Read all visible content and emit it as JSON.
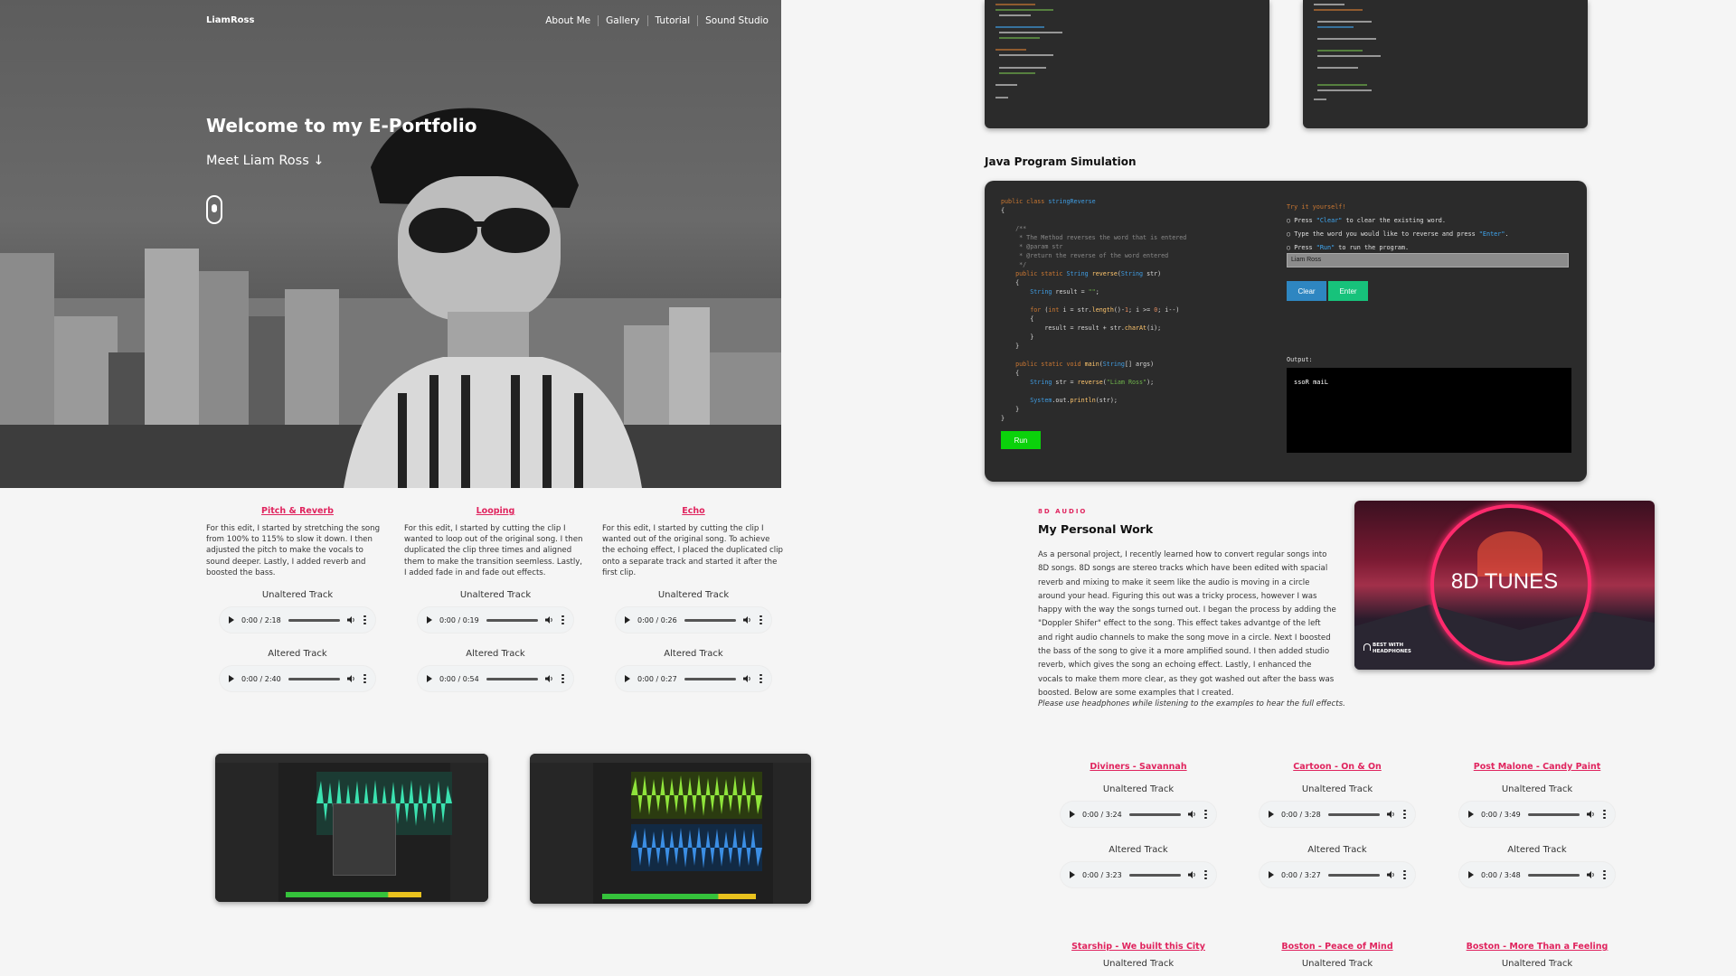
{
  "nav": {
    "logo": "LiamRoss",
    "links": [
      "About Me",
      "Gallery",
      "Tutorial",
      "Sound Studio"
    ]
  },
  "hero": {
    "title": "Welcome to my E-Portfolio",
    "subtitle": "Meet Liam Ross ↓"
  },
  "edits": [
    {
      "title": "Pitch & Reverb",
      "text": "For this edit, I started by stretching the song from 100% to 115% to slow it down. I then adjusted the pitch to make the vocals to sound deeper. Lastly, I added reverb and boosted the bass.",
      "unaltered_label": "Unaltered Track",
      "unaltered_time": "0:00 / 2:18",
      "altered_label": "Altered Track",
      "altered_time": "0:00 / 2:40"
    },
    {
      "title": "Looping",
      "text": "For this edit, I started by cutting the clip I wanted to loop out of the original song. I then duplicated the clip three times and aligned them to make the transition seemless. Lastly, I added fade in and fade out effects.",
      "unaltered_label": "Unaltered Track",
      "unaltered_time": "0:00 / 0:19",
      "altered_label": "Altered Track",
      "altered_time": "0:00 / 0:54"
    },
    {
      "title": "Echo",
      "text": "For this edit, I started by cutting the clip I wanted out of the original song. To achieve the echoing effect, I placed the duplicated clip onto a separate track and started it after the first clip.",
      "unaltered_label": "Unaltered Track",
      "unaltered_time": "0:00 / 0:26",
      "altered_label": "Altered Track",
      "altered_time": "0:00 / 0:27"
    }
  ],
  "java": {
    "section_title": "Java Program Simulation",
    "run_label": "Run",
    "try_head": "Try it yourself!",
    "instr1_a": "Press ",
    "instr1_q": "\"Clear\"",
    "instr1_b": " to clear the existing word.",
    "instr2_a": "Type the word you would like to reverse and press ",
    "instr2_q": "\"Enter\"",
    "instr2_b": ".",
    "instr3_a": "Press ",
    "instr3_q": "\"Run\"",
    "instr3_b": " to run the program.",
    "input_value": "Liam Ross",
    "clear_label": "Clear",
    "enter_label": "Enter",
    "output_label": "Output:",
    "output_value": "ssoR maiL"
  },
  "personal": {
    "eyebrow": "8D AUDIO",
    "title": "My Personal Work",
    "text": "As a personal project, I recently learned how to convert regular songs into 8D songs. 8D songs are stereo tracks which have been edited with spacial reverb and mixing to make it seem like the audio is moving in a circle around your head. Figuring this out was a tricky process, however I was happy with the way the songs turned out. I began the process by adding the \"Doppler Shifer\" effect to the song. This effect takes advantge of the left and right audio channels to make the song move in a circle. Next I boosted the bass of the song to give it a more amplified sound. I then added studio reverb, which gives the song an echoing effect. Lastly, I enhanced the vocals to make them more clear, as they got washed out after the bass was boosted. Below are some examples that I created.",
    "note": "Please use headphones while listening to the examples to hear the full effects.",
    "image_label": "8D TUNES",
    "headphone_line1": "BEST WITH",
    "headphone_line2": "HEADPHONES"
  },
  "songs": [
    {
      "title": "Diviners - Savannah",
      "unaltered_label": "Unaltered Track",
      "unaltered_time": "0:00 / 3:24",
      "altered_label": "Altered Track",
      "altered_time": "0:00 / 3:23"
    },
    {
      "title": "Cartoon - On & On",
      "unaltered_label": "Unaltered Track",
      "unaltered_time": "0:00 / 3:28",
      "altered_label": "Altered Track",
      "altered_time": "0:00 / 3:27"
    },
    {
      "title": "Post Malone - Candy Paint",
      "unaltered_label": "Unaltered Track",
      "unaltered_time": "0:00 / 3:49",
      "altered_label": "Altered Track",
      "altered_time": "0:00 / 3:48"
    }
  ],
  "songs2": [
    {
      "title": "Starship - We built this City",
      "unaltered_label": "Unaltered Track"
    },
    {
      "title": "Boston - Peace of Mind",
      "unaltered_label": "Unaltered Track"
    },
    {
      "title": "Boston - More Than a Feeling",
      "unaltered_label": "Unaltered Track"
    }
  ],
  "colors": {
    "accent_pink": "#e0245e",
    "run_green": "#0bd20b",
    "clear_blue": "#2e86c1",
    "enter_green": "#17c27b"
  }
}
